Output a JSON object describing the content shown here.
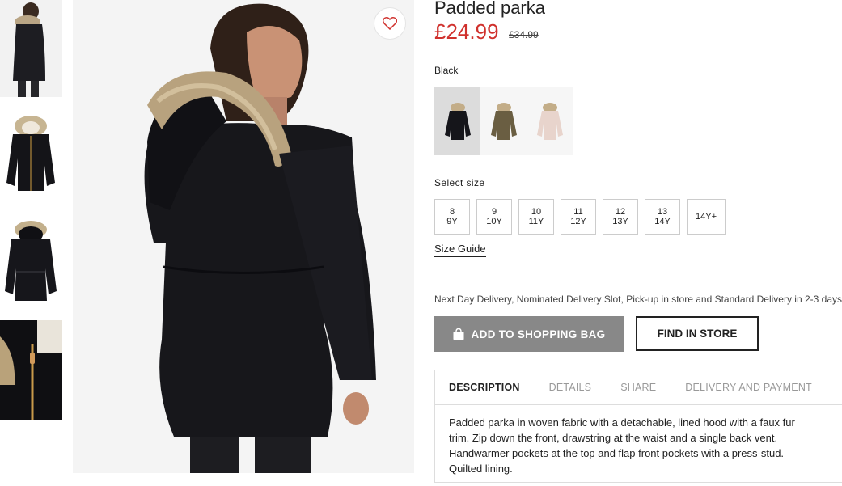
{
  "product": {
    "title": "Padded parka",
    "price": "£24.99",
    "old_price": "£34.99",
    "color_name": "Black",
    "swatches": [
      {
        "name": "black",
        "color": "#15151a"
      },
      {
        "name": "khaki",
        "color": "#6a5e42"
      },
      {
        "name": "light-pink",
        "color": "#e8d4cc"
      }
    ]
  },
  "size": {
    "label": "Select size",
    "options": [
      {
        "line1": "8",
        "line2": "9Y"
      },
      {
        "line1": "9",
        "line2": "10Y"
      },
      {
        "line1": "10",
        "line2": "11Y"
      },
      {
        "line1": "11",
        "line2": "12Y"
      },
      {
        "line1": "12",
        "line2": "13Y"
      },
      {
        "line1": "13",
        "line2": "14Y"
      },
      {
        "line1": "14Y+",
        "line2": ""
      }
    ],
    "guide": "Size Guide"
  },
  "delivery_text": "Next Day Delivery, Nominated Delivery Slot, Pick-up in store and Standard Delivery in 2-3 days.",
  "actions": {
    "add_to_bag": "ADD TO SHOPPING BAG",
    "find_in_store": "FIND IN STORE"
  },
  "tabs": [
    "DESCRIPTION",
    "DETAILS",
    "SHARE",
    "DELIVERY AND PAYMENT"
  ],
  "description": "Padded parka in woven fabric with a detachable, lined hood with a faux fur trim. Zip down the front, drawstring at the waist and a single back vent. Handwarmer pockets at the top and flap front pockets with a press-stud. Quilted lining.",
  "icons": {
    "wishlist": "heart-icon",
    "bag": "shopping-bag-icon"
  },
  "colors": {
    "price": "#d0312d",
    "heart": "#d0312d",
    "add_button": "#888888"
  }
}
